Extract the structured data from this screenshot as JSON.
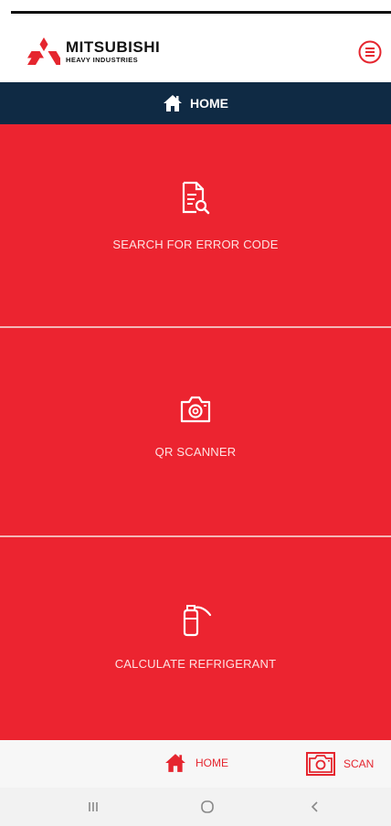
{
  "app": {
    "brand_name": "MITSUBISHI",
    "brand_sub": "HEAVY INDUSTRIES"
  },
  "header": {
    "menu_icon": "menu-circle-icon"
  },
  "navbar": {
    "title": "HOME",
    "icon": "home-icon"
  },
  "tiles": [
    {
      "label": "SEARCH FOR ERROR CODE",
      "icon": "document-search-icon"
    },
    {
      "label": "QR SCANNER",
      "icon": "camera-icon"
    },
    {
      "label": "CALCULATE REFRIGERANT",
      "icon": "refrigerant-cylinder-icon"
    }
  ],
  "bottom_nav": {
    "home_label": "HOME",
    "scan_label": "SCAN"
  },
  "colors": {
    "tile_red": "#ec2430",
    "navbar_navy": "#0f2a44",
    "accent_red": "#e5262f"
  }
}
